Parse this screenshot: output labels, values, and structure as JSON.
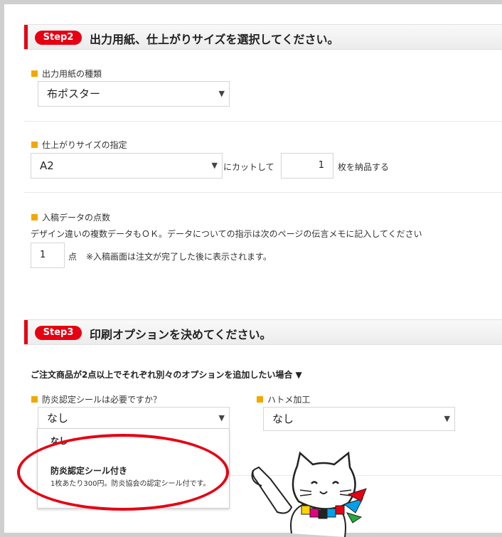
{
  "step2": {
    "badge": "Step2",
    "title": "出力用紙、仕上がりサイズを選択してください。",
    "paper": {
      "label": "出力用紙の種類",
      "selected": "布ポスター"
    },
    "size": {
      "label": "仕上がりサイズの指定",
      "selected": "A2",
      "cut_text": "にカットして",
      "quantity": "1",
      "quantity_suffix": "枚を納品する"
    },
    "data_count": {
      "label": "入稿データの点数",
      "description": "デザイン違いの複数データもＯＫ。データについての指示は次のページの伝言メモに記入してください",
      "value": "1",
      "unit": "点",
      "note": "※入稿画面は注文が完了した後に表示されます。"
    }
  },
  "step3": {
    "badge": "Step3",
    "title": "印刷オプションを決めてください。",
    "multi_note": "ご注文商品が2点以上でそれぞれ別々のオプションを追加したい場合 ▼",
    "fire_seal": {
      "label": "防炎認定シールは必要ですか？",
      "selected": "なし",
      "options": [
        {
          "label": "なし"
        },
        {
          "label": "防炎認定シール付き",
          "description": "1枚あたり300円。防炎協会の認定シール付です。"
        }
      ]
    },
    "grommet": {
      "label": "ハトメ加工",
      "selected": "なし"
    }
  },
  "icons": {
    "select_arrow": "▼"
  },
  "colors": {
    "accent": "#e60012",
    "label_marker": "#f3a800",
    "frame": "#cfcfcf"
  }
}
